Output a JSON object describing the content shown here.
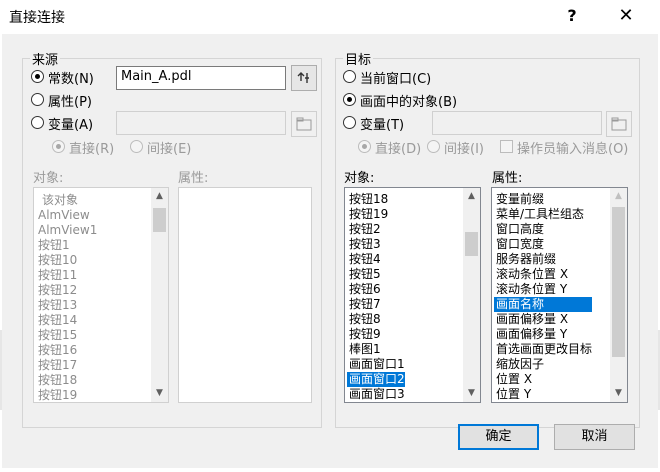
{
  "window": {
    "title": "直接连接",
    "help": "?",
    "close": "✕"
  },
  "source": {
    "group_title": "来源",
    "radio_constant": "常数(N)",
    "radio_property": "属性(P)",
    "radio_variable": "变量(A)",
    "constant_value": "Main_A.pdl",
    "variable_value": "",
    "radio_direct": "直接(R)",
    "radio_indirect": "间接(E)",
    "selected": "constant",
    "objects_label": "对象:",
    "properties_label": "属性:",
    "objects": [
      "该对象",
      "AlmView",
      "AlmView1",
      "按钮1",
      "按钮10",
      "按钮11",
      "按钮12",
      "按钮13",
      "按钮14",
      "按钮15",
      "按钮16",
      "按钮17",
      "按钮18",
      "按钮19"
    ],
    "properties": []
  },
  "target": {
    "group_title": "目标",
    "radio_current_window": "当前窗口(C)",
    "radio_object_in_screen": "画面中的对象(B)",
    "radio_variable": "变量(T)",
    "variable_value": "",
    "radio_direct": "直接(D)",
    "radio_indirect": "间接(I)",
    "checkbox_operator": "操作员输入消息(O)",
    "selected": "object_in_screen",
    "objects_label": "对象:",
    "properties_label": "属性:",
    "objects": [
      "按钮18",
      "按钮19",
      "按钮2",
      "按钮3",
      "按钮4",
      "按钮5",
      "按钮6",
      "按钮7",
      "按钮8",
      "按钮9",
      "棒图1",
      "画面窗口1",
      "画面窗口2",
      "画面窗口3"
    ],
    "selected_object": "画面窗口2",
    "properties": [
      "变量前缀",
      "菜单/工具栏组态",
      "窗口高度",
      "窗口宽度",
      "服务器前缀",
      "滚动条位置 X",
      "滚动条位置 Y",
      "画面名称",
      "画面偏移量 X",
      "画面偏移量 Y",
      "首选画面更改目标",
      "缩放因子",
      "位置 X",
      "位置 Y"
    ],
    "selected_property": "画面名称"
  },
  "buttons": {
    "ok": "确定",
    "cancel": "取消"
  },
  "icons": {
    "browse": "tag-select-icon",
    "folder": "folder-icon",
    "scroll_up": "scroll-up-arrow-icon",
    "scroll_down": "scroll-down-arrow-icon"
  },
  "colors": {
    "selection": "#0078d7",
    "dialog_bg": "#f0f0f0",
    "default_button_border": "#0078d7"
  }
}
